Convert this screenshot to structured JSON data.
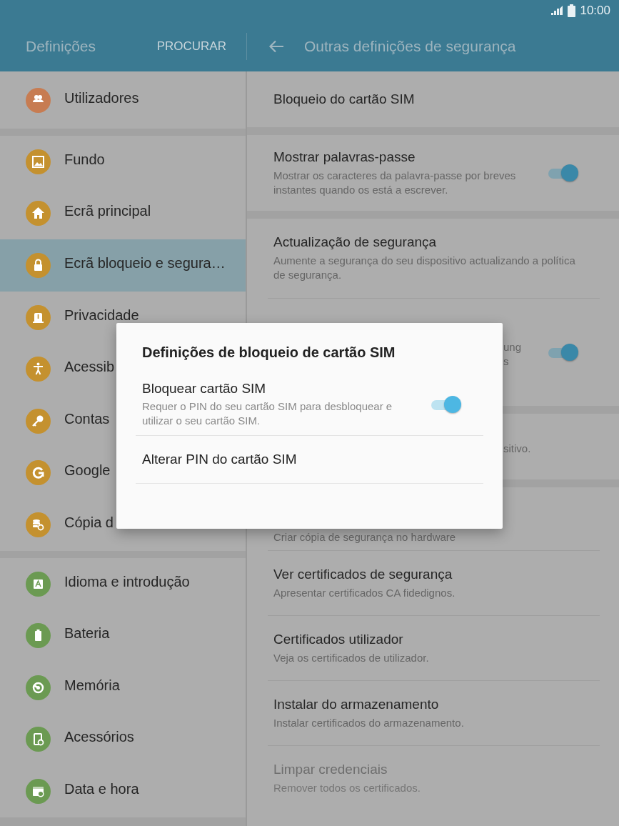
{
  "status_bar": {
    "time": "10:00"
  },
  "app_bar": {
    "title": "Definições",
    "search_button": "PROCURAR",
    "page_title": "Outras definições de segurança"
  },
  "sidebar": {
    "groups": [
      {
        "items": [
          {
            "label": "Utilizadores",
            "color": "#c77c52",
            "selected": false
          }
        ]
      },
      {
        "items": [
          {
            "label": "Fundo",
            "color": "#c4912f",
            "selected": false
          },
          {
            "label": "Ecrã principal",
            "color": "#c4912f",
            "selected": false
          },
          {
            "label": "Ecrã bloqueio e segura…",
            "color": "#c4912f",
            "selected": true
          },
          {
            "label": "Privacidade",
            "color": "#c4912f",
            "selected": false
          },
          {
            "label": "Acessib",
            "color": "#c4912f",
            "selected": false
          },
          {
            "label": "Contas",
            "color": "#c4912f",
            "selected": false
          },
          {
            "label": "Google",
            "color": "#c4912f",
            "selected": false
          },
          {
            "label": "Cópia d",
            "color": "#c4912f",
            "selected": false
          }
        ]
      },
      {
        "items": [
          {
            "label": "Idioma e introdução",
            "color": "#6b9a52",
            "selected": false
          },
          {
            "label": "Bateria",
            "color": "#6b9a52",
            "selected": false
          },
          {
            "label": "Memória",
            "color": "#6b9a52",
            "selected": false
          },
          {
            "label": "Acessórios",
            "color": "#6b9a52",
            "selected": false
          },
          {
            "label": "Data e hora",
            "color": "#6b9a52",
            "selected": false
          }
        ]
      }
    ]
  },
  "content": {
    "sections": [
      {
        "items": [
          {
            "kind": "plain",
            "title": "Bloqueio do cartão SIM",
            "disabled": false
          }
        ]
      },
      {
        "items": [
          {
            "kind": "plain",
            "title": "Mostrar palavras-passe",
            "description": "Mostrar os caracteres da palavra-passe por breves instantes quando os está a escrever.",
            "toggle": {
              "on": true
            },
            "disabled": false
          }
        ]
      },
      {
        "items": [
          {
            "kind": "plain",
            "title": "Actualização de segurança",
            "description": "Aumente a segurança do seu dispositivo actualizando a política de segurança.",
            "disabled": false
          },
          {
            "kind": "covered",
            "description": "ung\ns",
            "toggle": {
              "on": true
            },
            "disabled": false
          }
        ]
      },
      {
        "items": [
          {
            "kind": "covered",
            "description": "sitivo.",
            "disabled": false
          }
        ]
      },
      {
        "items": [
          {
            "kind": "covered-top",
            "description": "Criar cópia de segurança no hardware",
            "disabled": false
          },
          {
            "kind": "plain",
            "title": "Ver certificados de segurança",
            "description": "Apresentar certificados CA fidedignos.",
            "disabled": false
          },
          {
            "kind": "plain",
            "title": "Certificados utilizador",
            "description": "Veja os certificados de utilizador.",
            "disabled": false
          },
          {
            "kind": "plain",
            "title": "Instalar do armazenamento",
            "description": "Instalar certificados do armazenamento.",
            "disabled": false
          },
          {
            "kind": "plain",
            "title": "Limpar credenciais",
            "description": "Remover todos os certificados.",
            "disabled": true
          }
        ]
      }
    ]
  },
  "dialog": {
    "title": "Definições de bloqueio de cartão SIM",
    "items": [
      {
        "title": "Bloquear cartão SIM",
        "description": "Requer o PIN do seu cartão SIM para desbloquear e utilizar o seu cartão SIM.",
        "toggle": {
          "on": true
        }
      },
      {
        "title": "Alterar PIN do cartão SIM"
      }
    ]
  }
}
